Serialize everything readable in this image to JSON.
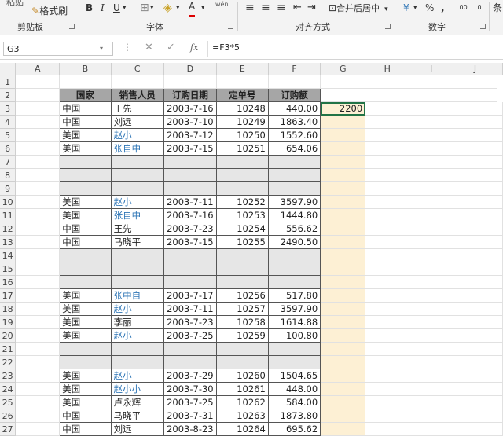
{
  "ribbon": {
    "paste": "粘贴",
    "format_painter": "格式刷",
    "clipboard_label": "剪贴板",
    "font_label": "字体",
    "alignment_label": "对齐方式",
    "number_label": "数字",
    "merge_center": "合并后居中",
    "bold": "B",
    "italic": "I",
    "underline": "U",
    "font_color": "A",
    "fill_color": "A",
    "phonetic": "wén",
    "percent": "%",
    "comma": ",",
    "dec_increase": ".00",
    "dec_decrease": ".0",
    "currency": "¥",
    "more": "条"
  },
  "formula_bar": {
    "name_box": "G3",
    "fx": "fx",
    "formula": "=F3*5"
  },
  "columns": [
    "A",
    "B",
    "C",
    "D",
    "E",
    "F",
    "G",
    "H",
    "I",
    "J"
  ],
  "header": [
    "国家",
    "销售人员",
    "订购日期",
    "定单号",
    "订购额"
  ],
  "g3": "2200",
  "rows": [
    {
      "n": "3",
      "data": [
        "中国",
        "王先",
        "2003-7-16",
        "10248",
        "440.00"
      ]
    },
    {
      "n": "4",
      "data": [
        "中国",
        "刘远",
        "2003-7-10",
        "10249",
        "1863.40"
      ]
    },
    {
      "n": "5",
      "data": [
        "美国",
        "赵小",
        "2003-7-12",
        "10250",
        "1552.60"
      ]
    },
    {
      "n": "6",
      "data": [
        "美国",
        "张自中",
        "2003-7-15",
        "10251",
        "654.06"
      ]
    },
    {
      "n": "7",
      "data": null
    },
    {
      "n": "8",
      "data": null
    },
    {
      "n": "9",
      "data": null
    },
    {
      "n": "10",
      "data": [
        "美国",
        "赵小",
        "2003-7-11",
        "10252",
        "3597.90"
      ]
    },
    {
      "n": "11",
      "data": [
        "美国",
        "张自中",
        "2003-7-16",
        "10253",
        "1444.80"
      ]
    },
    {
      "n": "12",
      "data": [
        "中国",
        "王先",
        "2003-7-23",
        "10254",
        "556.62"
      ]
    },
    {
      "n": "13",
      "data": [
        "中国",
        "马晓平",
        "2003-7-15",
        "10255",
        "2490.50"
      ]
    },
    {
      "n": "14",
      "data": null
    },
    {
      "n": "15",
      "data": null
    },
    {
      "n": "16",
      "data": null
    },
    {
      "n": "17",
      "data": [
        "美国",
        "张中自",
        "2003-7-17",
        "10256",
        "517.80"
      ]
    },
    {
      "n": "18",
      "data": [
        "美国",
        "赵小",
        "2003-7-11",
        "10257",
        "3597.90"
      ]
    },
    {
      "n": "19",
      "data": [
        "美国",
        "李丽",
        "2003-7-23",
        "10258",
        "1614.88"
      ]
    },
    {
      "n": "20",
      "data": [
        "美国",
        "赵小",
        "2003-7-25",
        "10259",
        "100.80"
      ]
    },
    {
      "n": "21",
      "data": null
    },
    {
      "n": "22",
      "data": null
    },
    {
      "n": "23",
      "data": [
        "美国",
        "赵小",
        "2003-7-29",
        "10260",
        "1504.65"
      ]
    },
    {
      "n": "24",
      "data": [
        "美国",
        "赵小小",
        "2003-7-30",
        "10261",
        "448.00"
      ]
    },
    {
      "n": "25",
      "data": [
        "美国",
        "卢永辉",
        "2003-7-25",
        "10262",
        "584.00"
      ]
    },
    {
      "n": "26",
      "data": [
        "中国",
        "马晓平",
        "2003-7-31",
        "10263",
        "1873.80"
      ]
    },
    {
      "n": "27",
      "data": [
        "中国",
        "刘远",
        "2003-8-23",
        "10264",
        "695.62"
      ]
    }
  ]
}
